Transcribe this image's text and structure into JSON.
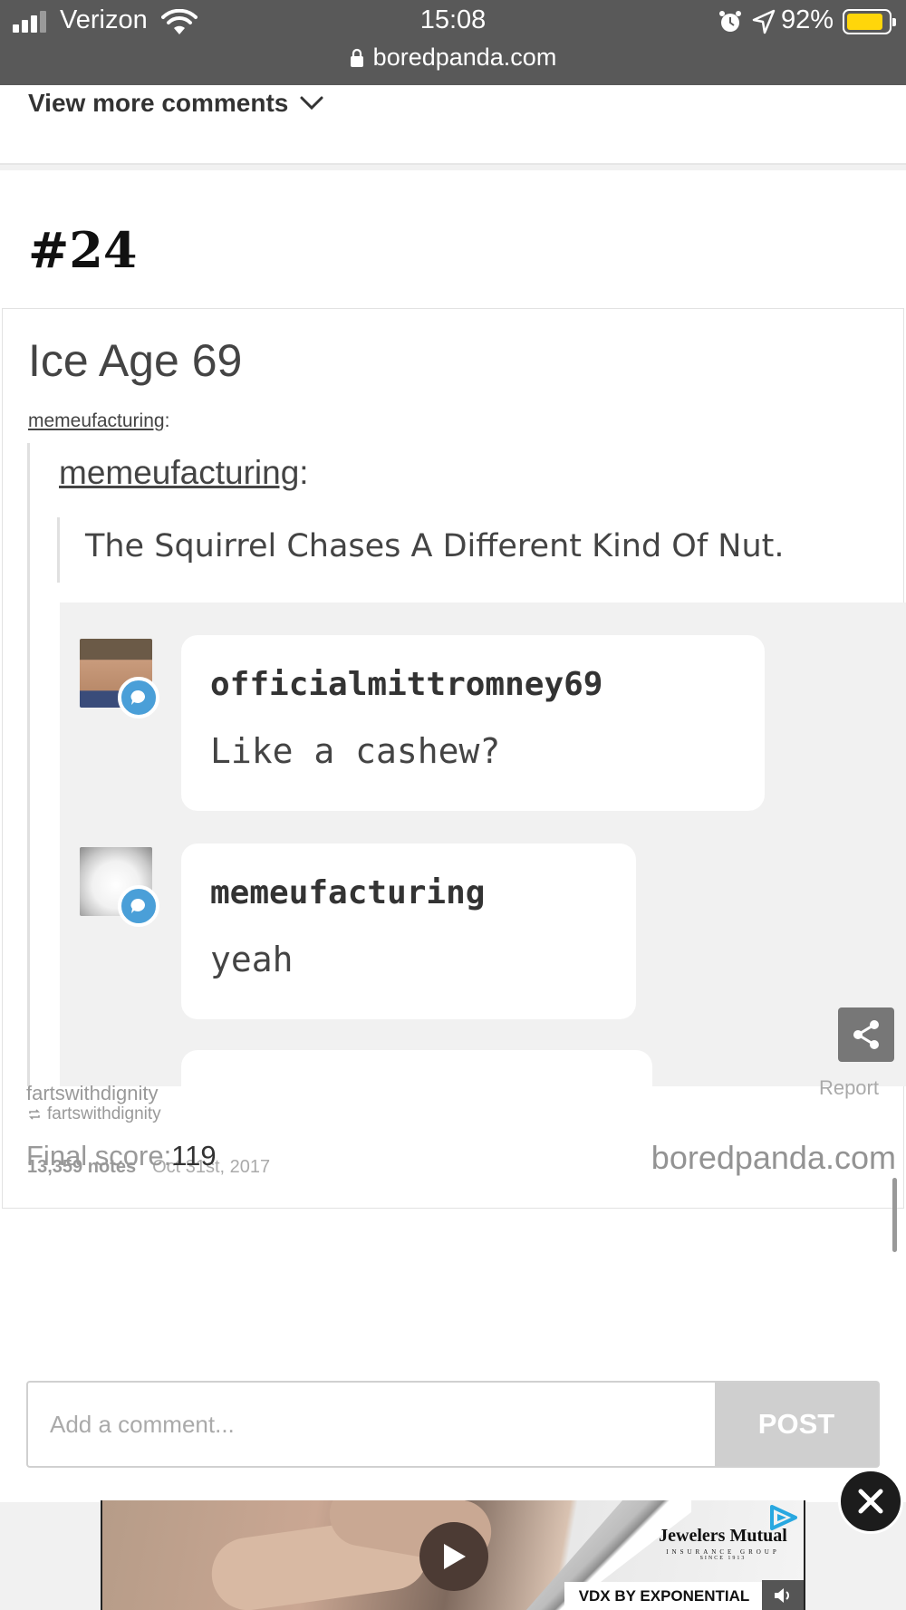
{
  "status_bar": {
    "carrier": "Verizon",
    "time": "15:08",
    "battery_percent": "92%",
    "battery_level": 0.92,
    "url": "boredpanda.com"
  },
  "view_more": {
    "label": "View more comments"
  },
  "post": {
    "number": "#24",
    "embed": {
      "title": "Ice Age 69",
      "poster": "memeufacturing",
      "poster_suffix": ":",
      "quote_user": "memeufacturing",
      "quote_suffix": ":",
      "quote_text": "The Squirrel Chases A Different Kind Of Nut.",
      "chat": [
        {
          "name": "officialmittromney69",
          "text": "Like a cashew?"
        },
        {
          "name": "memeufacturing",
          "text": "yeah"
        }
      ],
      "reblog_user": "fartswithdignity",
      "notes": "13,359 notes",
      "date": "Oct 31st, 2017",
      "watermark": "boredpanda.com"
    },
    "source_user": "fartswithdignity",
    "report_label": "Report",
    "final_score_label": "Final score:",
    "final_score_value": "119"
  },
  "comment": {
    "placeholder": "Add a comment...",
    "post_label": "POST"
  },
  "ad": {
    "brand": "Jewelers Mutual",
    "brand_sub": "INSURANCE GROUP",
    "brand_since": "SINCE 1913",
    "vdx_label": "VDX BY EXPONENTIAL"
  },
  "colors": {
    "accent_blue": "#4a9fd8",
    "battery_yellow": "#ffd60a"
  }
}
